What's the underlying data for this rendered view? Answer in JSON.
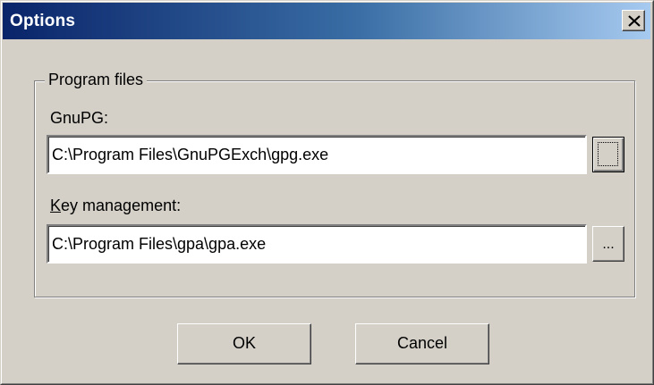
{
  "window": {
    "title": "Options",
    "close_glyph": "✕"
  },
  "group": {
    "legend": "Program files"
  },
  "gnupg": {
    "label": "GnuPG:",
    "value": "C:\\Program Files\\GnuPGExch\\gpg.exe",
    "browse_label": "..."
  },
  "keymgmt": {
    "label_mnemonic": "K",
    "label_rest": "ey management:",
    "value": "C:\\Program Files\\gpa\\gpa.exe",
    "browse_label": "..."
  },
  "buttons": {
    "ok": "OK",
    "cancel": "Cancel"
  },
  "icons": {
    "close": "close-icon"
  },
  "colors": {
    "face": "#d4d0c8",
    "title_start": "#0a246a",
    "title_end": "#a6caf0"
  }
}
